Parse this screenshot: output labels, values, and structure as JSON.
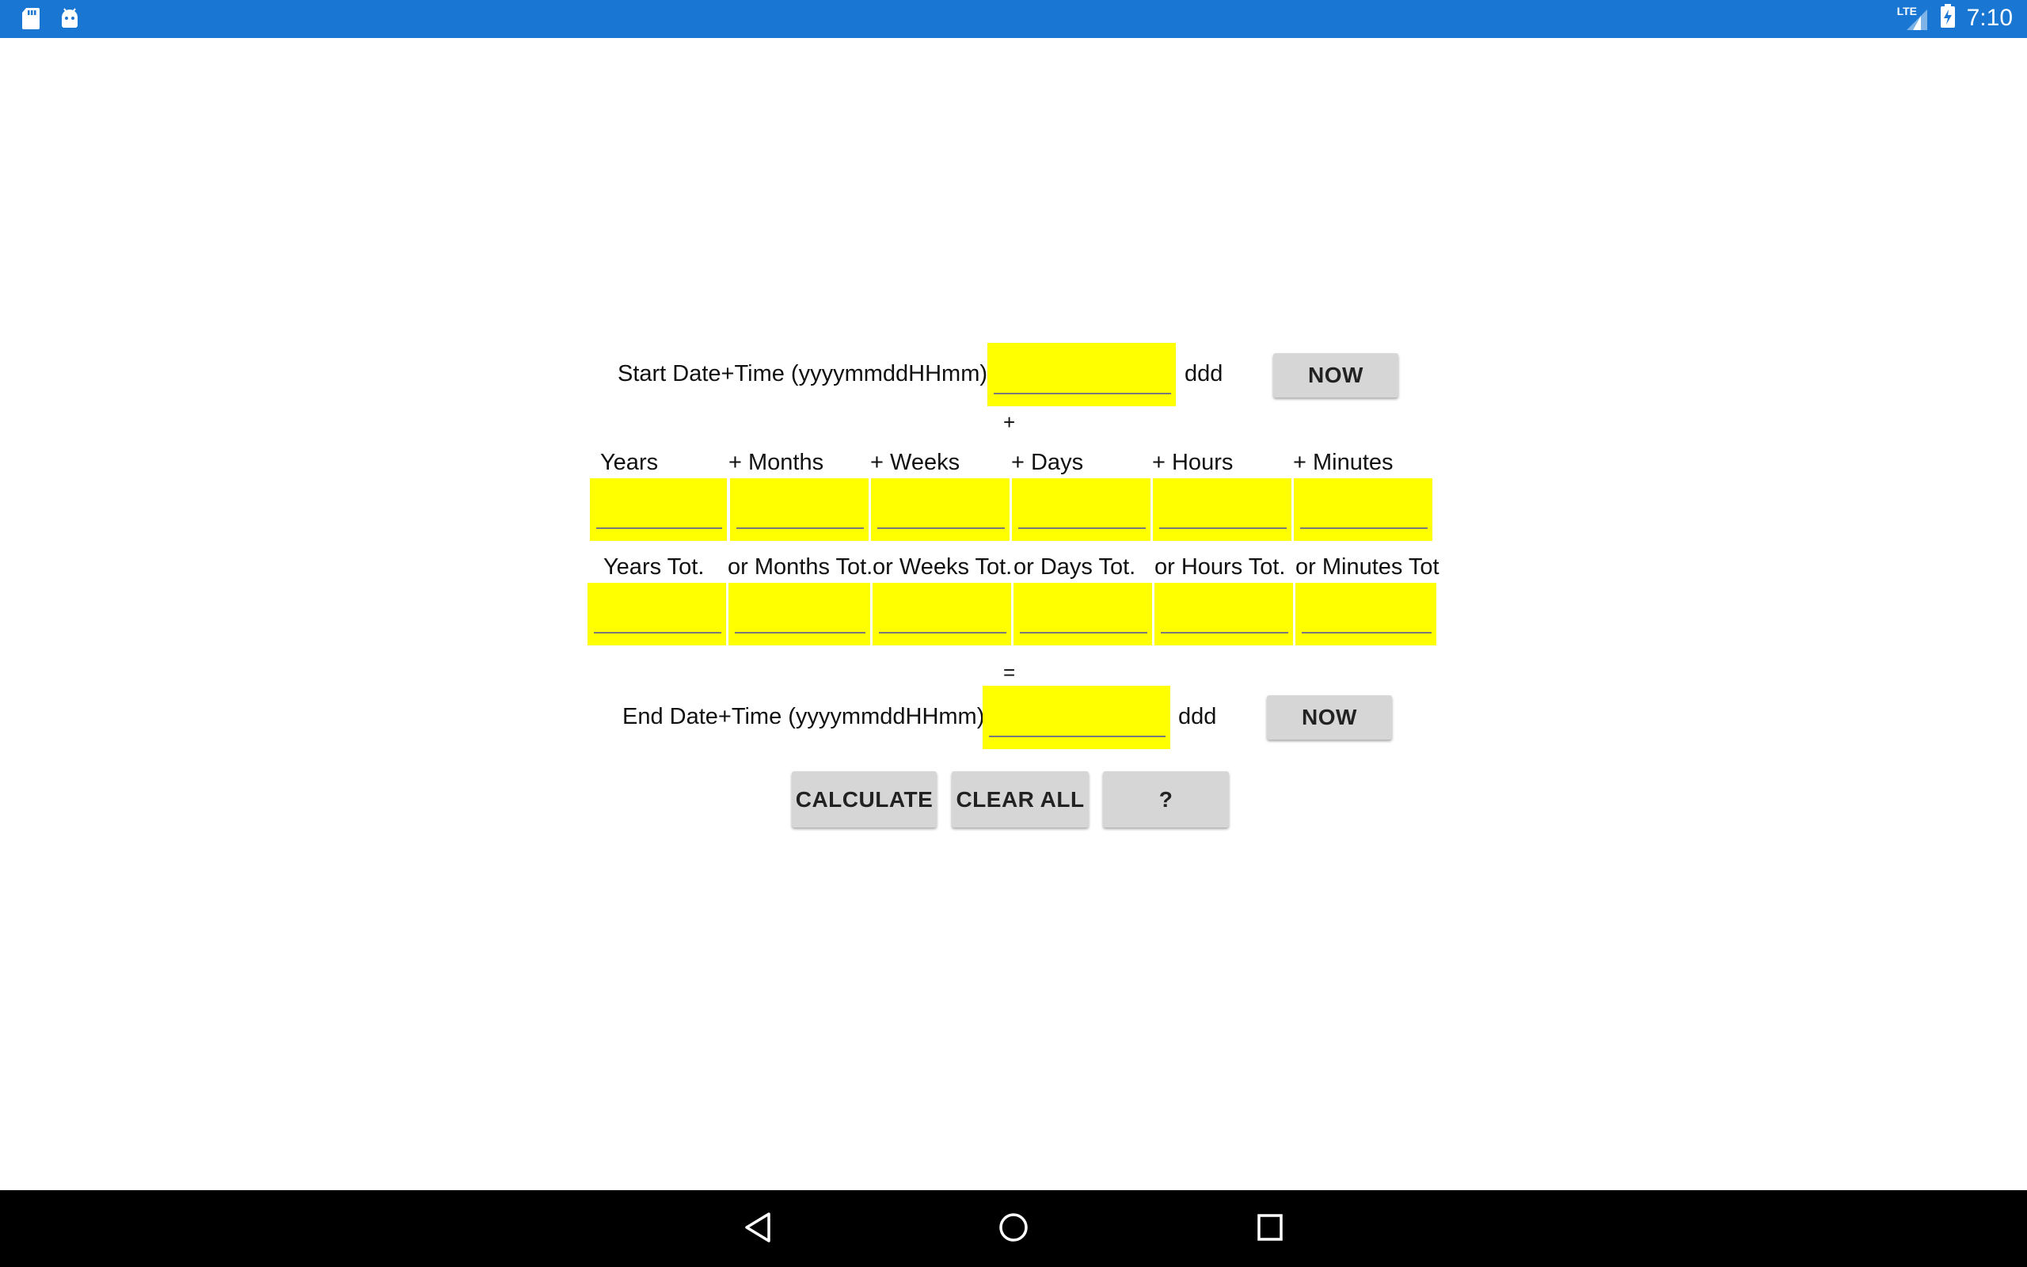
{
  "status_bar": {
    "time": "7:10",
    "network": "LTE",
    "left_icons": [
      "sd-card-icon",
      "android-icon"
    ],
    "color": "#1976d2"
  },
  "form": {
    "start_label": "Start Date+Time (yyyymmddHHmm)",
    "start_value": "",
    "start_dow": "ddd",
    "start_now": "NOW",
    "plus_sign": "+",
    "offsets_headers": [
      "Years",
      "+ Months",
      "+ Weeks",
      "+ Days",
      "+ Hours",
      "+ Minutes"
    ],
    "offsets_values": [
      "",
      "",
      "",
      "",
      "",
      ""
    ],
    "totals_headers": [
      "Years Tot.",
      "or Months Tot.",
      "or Weeks Tot.",
      "or Days Tot.",
      "or Hours Tot.",
      "or Minutes Tot"
    ],
    "totals_values": [
      "",
      "",
      "",
      "",
      "",
      ""
    ],
    "equals_sign": "=",
    "end_label": "End Date+Time (yyyymmddHHmm)",
    "end_value": "",
    "end_dow": "ddd",
    "end_now": "NOW",
    "field_color": "#ffff00"
  },
  "actions": {
    "calculate": "CALCULATE",
    "clear_all": "CLEAR ALL",
    "help": "?"
  },
  "nav_bar": {
    "icons": [
      "back-icon",
      "home-icon",
      "recents-icon"
    ]
  }
}
